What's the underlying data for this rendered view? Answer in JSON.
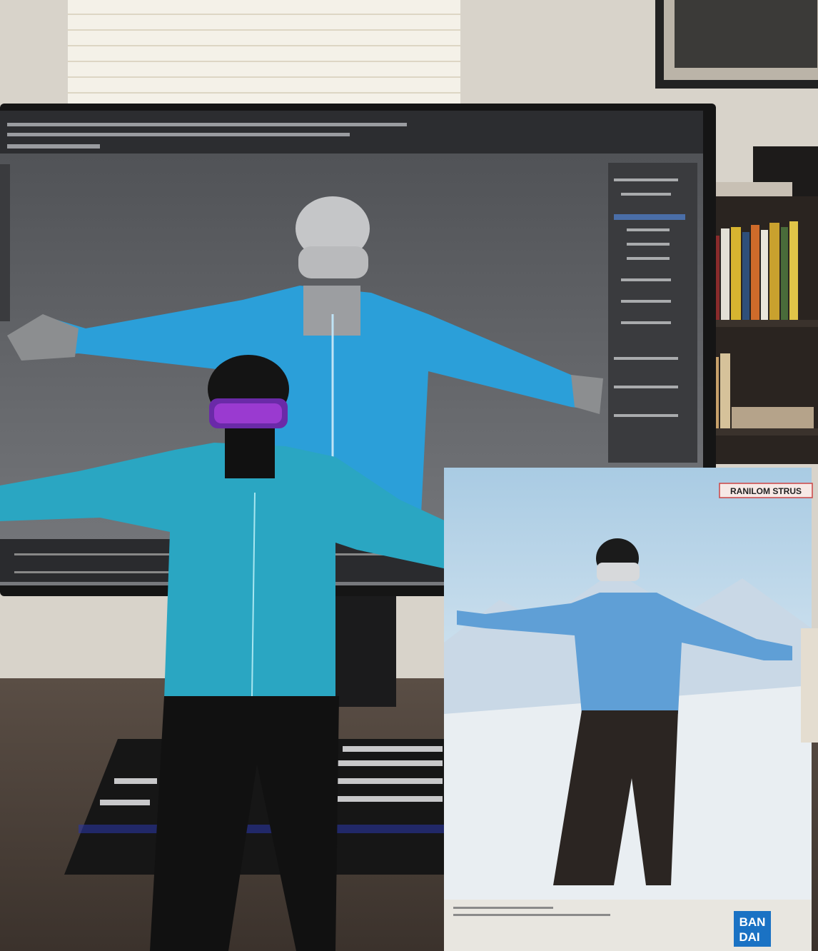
{
  "scene": {
    "description_kind": "photo",
    "box": {
      "brand_label": "RANILOM STRUS",
      "logo_line1": "BAN",
      "logo_line2": "DAI"
    },
    "colors": {
      "wall": "#d8d3ca",
      "desk": "#4a3f37",
      "jacket_figure": "#2aa6c2",
      "jacket_model": "#2b9fd9",
      "jacket_box": "#5f9fd6",
      "bandai_blue": "#1a72c4",
      "viewport": "#5f6165"
    }
  }
}
